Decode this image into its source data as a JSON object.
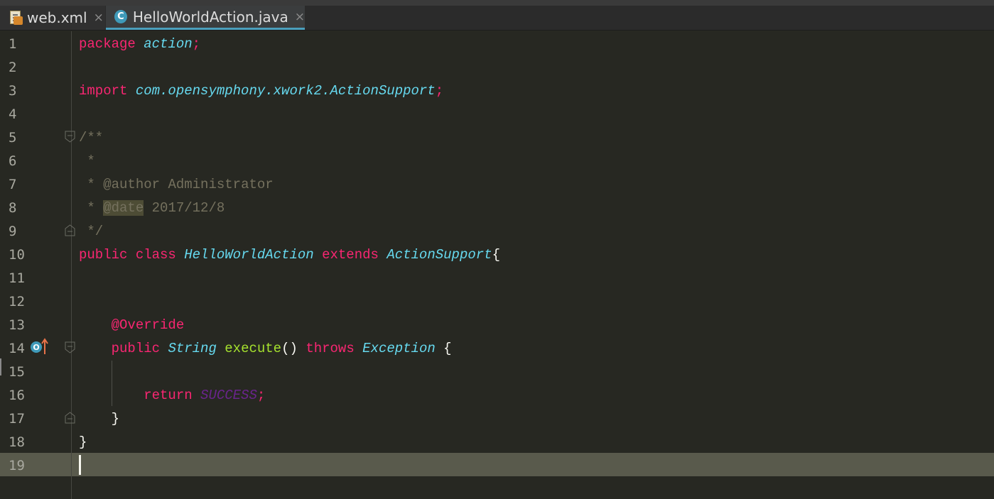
{
  "tabs": [
    {
      "label": "web.xml",
      "icon": "xml-file-icon",
      "close": "×"
    },
    {
      "label": "HelloWorldAction.java",
      "icon": "java-class-icon",
      "class_badge": "C",
      "close": "×",
      "active": true
    }
  ],
  "editor": {
    "line_numbers": [
      "1",
      "2",
      "3",
      "4",
      "5",
      "6",
      "7",
      "8",
      "9",
      "10",
      "11",
      "12",
      "13",
      "14",
      "15",
      "16",
      "17",
      "18",
      "19"
    ],
    "current_line": "19",
    "gutter": {
      "override_badge": "O",
      "override_arrow": "↑"
    },
    "code": {
      "l1": {
        "kw": "package",
        "name": "action",
        "semi": ";"
      },
      "l3": {
        "kw": "import",
        "name": "com.opensymphony.xwork2.ActionSupport",
        "semi": ";"
      },
      "l5": "/**",
      "l6": " *",
      "l7": {
        "star": " * ",
        "tag": "@author",
        "text": " Administrator"
      },
      "l8": {
        "star": " * ",
        "tag": "@date",
        "text": " 2017/12/8"
      },
      "l9": " */",
      "l10": {
        "kw1": "public",
        "kw2": "class",
        "name": "HelloWorldAction",
        "kw3": "extends",
        "parent": "ActionSupport",
        "brace": "{"
      },
      "l13": {
        "annotation": "@Override"
      },
      "l14": {
        "kw1": "public",
        "type": "String",
        "method": "execute",
        "parens": "()",
        "kw2": "throws",
        "exc": "Exception",
        "brace": "{"
      },
      "l16": {
        "kw": "return",
        "const": "SUCCESS",
        "semi": ";"
      },
      "l17": "}",
      "l18": "}"
    }
  },
  "colors": {
    "background": "#272822",
    "keyword": "#f92672",
    "type": "#66d9ef",
    "method": "#a6e22e",
    "comment": "#75715e",
    "constant": "#6a248c",
    "current_line": "#595a4c",
    "active_tab_underline": "#4a9fbd"
  }
}
